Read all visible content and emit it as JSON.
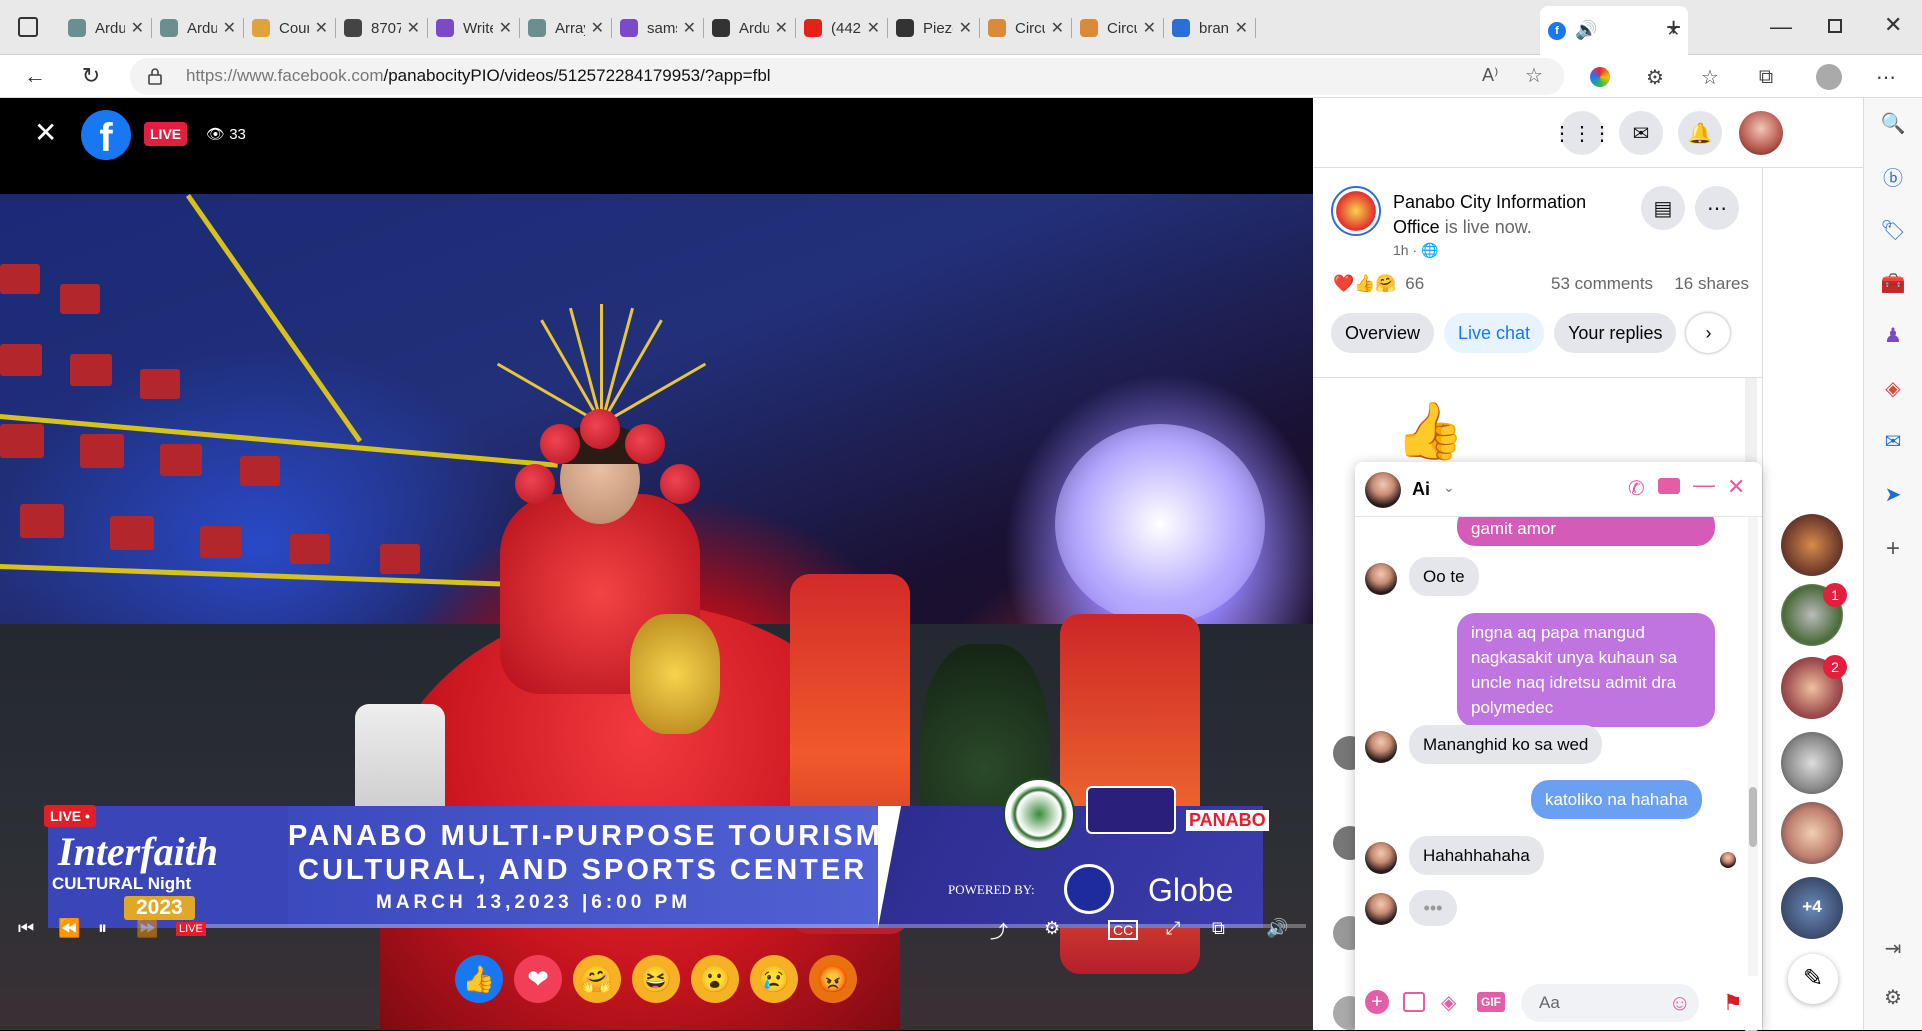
{
  "browser": {
    "tabs": [
      {
        "title": "Arduino",
        "color": "#6b8f8f"
      },
      {
        "title": "Arduino",
        "color": "#6b8f8f"
      },
      {
        "title": "Course",
        "color": "#e0a23b"
      },
      {
        "title": "8707",
        "color": "#444444"
      },
      {
        "title": "Write",
        "color": "#7a4ac8"
      },
      {
        "title": "Array",
        "color": "#6b8f8f"
      },
      {
        "title": "samsung",
        "color": "#7a4ac8"
      },
      {
        "title": "Arduino",
        "color": "#333333"
      },
      {
        "title": "(442",
        "color": "#e62117"
      },
      {
        "title": "Piezo",
        "color": "#333333"
      },
      {
        "title": "Circuit",
        "color": "#d98b3a"
      },
      {
        "title": "Circuit",
        "color": "#d98b3a"
      },
      {
        "title": "brand",
        "color": "#2b6fd6"
      }
    ],
    "active_tab_icon": "facebook-icon",
    "url_host": "https://www.facebook.com",
    "url_path": "/panabocityPIO/videos/512572284179953/?app=fbl"
  },
  "video": {
    "live_label": "LIVE",
    "viewers": "33",
    "banner": {
      "live_tag": "LIVE •",
      "interfaith_line1": "Interfaith",
      "interfaith_line2": "CULTURAL  Night",
      "interfaith_year": "2023",
      "venue_line1": "PANABO MULTI-PURPOSE TOURISM,",
      "venue_line2": "CULTURAL, AND SPORTS CENTER",
      "date_line": "MARCH 13,2023 |6:00 PM",
      "powered_by": "POWERED BY:",
      "sponsor": "Globe",
      "seal_text": "PANABO"
    },
    "progress": 0.0
  },
  "post": {
    "page_name": "Panabo City Information Office",
    "status_suffix": " is live now.",
    "time": "1h ·",
    "reaction_count": "66",
    "comments": "53 comments",
    "shares": "16 shares",
    "tabs": [
      "Overview",
      "Live chat",
      "Your replies"
    ]
  },
  "chat": {
    "contact_name": "Ai",
    "messages": [
      {
        "dir": "out",
        "text": "gamit amor"
      },
      {
        "dir": "in",
        "text": "Oo te"
      },
      {
        "dir": "out",
        "text": "ingna aq papa mangud nagkasakit unya kuhaun sa uncle naq idretsu admit dra polymedec"
      },
      {
        "dir": "in",
        "text": "Mananghid ko sa wed"
      },
      {
        "dir": "out",
        "text": "katoliko na hahaha"
      },
      {
        "dir": "in",
        "text": "Hahahhahaha"
      }
    ],
    "input_placeholder": "Aa",
    "out_color_top": "#b85fd8",
    "out_color_bottom": "#5b8ef0"
  },
  "contacts": {
    "badges": [
      "1",
      "2"
    ],
    "more": "+4"
  }
}
